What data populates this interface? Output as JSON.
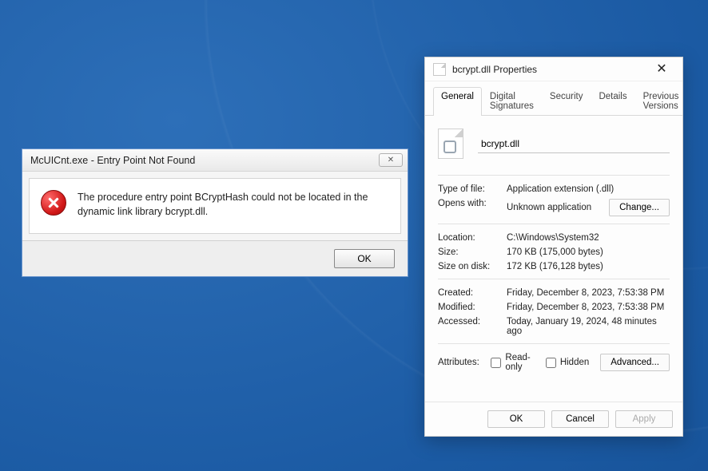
{
  "errorDialog": {
    "title": "McUICnt.exe - Entry Point Not Found",
    "message": "The procedure entry point BCryptHash could not be located in the dynamic link library bcrypt.dll.",
    "okLabel": "OK",
    "closeGlyph": "✕"
  },
  "propsDialog": {
    "title": "bcrypt.dll Properties",
    "closeGlyph": "✕",
    "tabs": [
      "General",
      "Digital Signatures",
      "Security",
      "Details",
      "Previous Versions"
    ],
    "activeTab": 0,
    "filename": "bcrypt.dll",
    "fields": {
      "typeOfFile": {
        "label": "Type of file:",
        "value": "Application extension (.dll)"
      },
      "opensWith": {
        "label": "Opens with:",
        "value": "Unknown application",
        "changeLabel": "Change..."
      },
      "location": {
        "label": "Location:",
        "value": "C:\\Windows\\System32"
      },
      "size": {
        "label": "Size:",
        "value": "170 KB (175,000 bytes)"
      },
      "sizeOnDisk": {
        "label": "Size on disk:",
        "value": "172 KB (176,128 bytes)"
      },
      "created": {
        "label": "Created:",
        "value": "Friday, December 8, 2023, 7:53:38 PM"
      },
      "modified": {
        "label": "Modified:",
        "value": "Friday, December 8, 2023, 7:53:38 PM"
      },
      "accessed": {
        "label": "Accessed:",
        "value": "Today, January 19, 2024, 48 minutes ago"
      }
    },
    "attributes": {
      "label": "Attributes:",
      "readOnly": {
        "label": "Read-only",
        "checked": false
      },
      "hidden": {
        "label": "Hidden",
        "checked": false
      },
      "advancedLabel": "Advanced..."
    },
    "footer": {
      "ok": "OK",
      "cancel": "Cancel",
      "apply": "Apply"
    }
  }
}
